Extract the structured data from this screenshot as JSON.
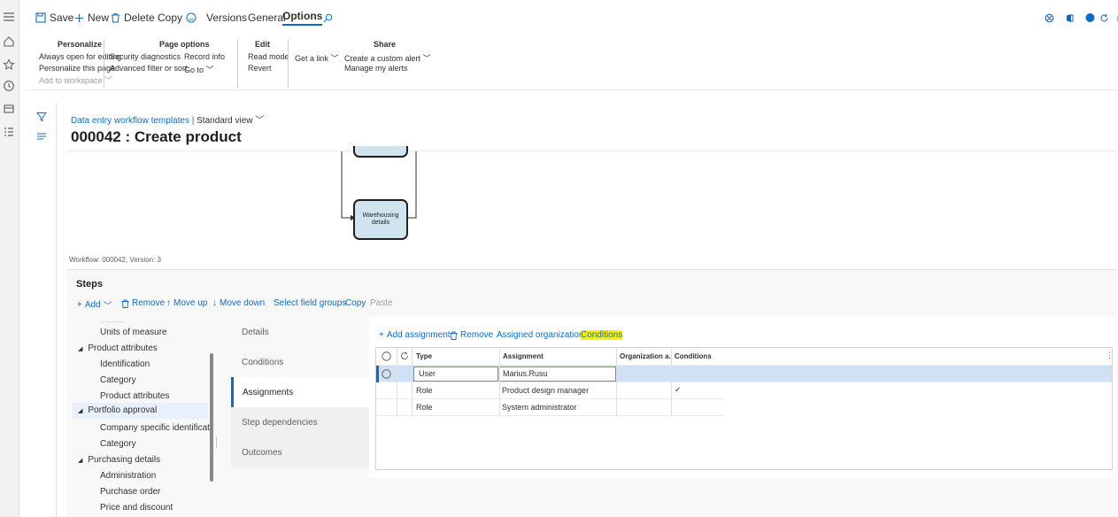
{
  "actionbar": {
    "save": "Save",
    "new": "New",
    "delete": "Delete",
    "copy": "Copy",
    "versions": "Versions",
    "general": "General",
    "options": "Options"
  },
  "ribbon": {
    "personalize": {
      "title": "Personalize",
      "items": [
        "Always open for editing",
        "Personalize this page",
        "Add to workspace"
      ]
    },
    "page_options": {
      "title": "Page options",
      "items": [
        "Security diagnostics",
        "Advanced filter or sort",
        "Record info",
        "Go to"
      ]
    },
    "edit": {
      "title": "Edit",
      "items": [
        "Read mode",
        "Revert"
      ]
    },
    "share": {
      "title": "Share",
      "items": [
        "Get a link",
        "Create a custom alert",
        "Manage my alerts"
      ]
    }
  },
  "page": {
    "breadcrumb": "Data entry workflow templates",
    "separator": "|",
    "view": "Standard view",
    "title": "000042 : Create product"
  },
  "designer": {
    "node_label": "Warehousing details",
    "workflow_info": "Workflow: 000042, Version: 3"
  },
  "steps": {
    "title": "Steps",
    "toolbar": {
      "add": "Add",
      "remove": "Remove",
      "move_up": "Move up",
      "move_down": "Move down",
      "select_field_groups": "Select field groups",
      "copy": "Copy",
      "paste": "Paste"
    },
    "tree": [
      "Units of measure",
      "Product attributes",
      "Identification",
      "Category",
      "Product attributes",
      "Portfolio approval",
      "Company specific identification",
      "Category",
      "Purchasing details",
      "Administration",
      "Purchase order",
      "Price and discount"
    ],
    "tabs": [
      "Details",
      "Conditions",
      "Assignments",
      "Step dependencies",
      "Outcomes"
    ]
  },
  "assignments": {
    "toolbar": {
      "add": "Add assignment",
      "remove": "Remove",
      "assigned_orgs": "Assigned organizations",
      "conditions": "Conditions"
    },
    "columns": [
      "Type",
      "Assignment",
      "Organization a...",
      "Conditions"
    ],
    "rows": [
      {
        "type": "User",
        "assignment": "Marius.Rusu",
        "conditions": ""
      },
      {
        "type": "Role",
        "assignment": "Product design manager",
        "conditions": "✓"
      },
      {
        "type": "Role",
        "assignment": "System administrator",
        "conditions": ""
      }
    ]
  },
  "colors": {
    "accent": "#0f6cbd",
    "highlight": "#fff100",
    "selected_row": "#cfe0f7",
    "node_fill": "#cfe4ef"
  },
  "icons": [
    "hamburger-icon",
    "home-icon",
    "star-icon",
    "clock-icon",
    "workspace-icon",
    "list-icon",
    "save-icon",
    "plus-icon",
    "trash-icon",
    "smiley-icon",
    "search-icon",
    "filter-icon",
    "settings-icon",
    "office-icon",
    "notification-icon",
    "refresh-icon",
    "expand-icon"
  ]
}
